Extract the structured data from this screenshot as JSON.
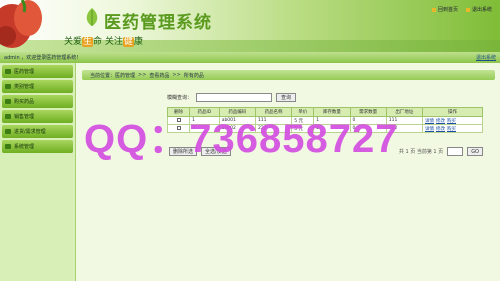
{
  "header": {
    "title": "医药管理系统",
    "slogan_parts": [
      "关爱",
      "生",
      "命  关注",
      "健",
      "康"
    ],
    "top_links": [
      "回到首页",
      "退出系统"
    ]
  },
  "welcome": {
    "text": "admin ，欢迎登录医药管理系统！",
    "logout": "退出系统"
  },
  "sidebar": {
    "items": [
      {
        "label": "医药管理"
      },
      {
        "label": "类别管理"
      },
      {
        "label": "购买药品"
      },
      {
        "label": "销售管理"
      },
      {
        "label": "进货/需求管理"
      },
      {
        "label": "系统管理"
      }
    ]
  },
  "breadcrumb": [
    "当前位置：医药管理",
    "查看药品",
    "所有药品"
  ],
  "breadcrumb_sep": ">>",
  "search": {
    "label": "模糊查询：",
    "button": "查询",
    "placeholder": ""
  },
  "table": {
    "headers": [
      "删除",
      "药品ID",
      "药品编码",
      "药品名称",
      "单价",
      "库存数量",
      "需求数量",
      "出厂地址",
      "操作"
    ],
    "rows": [
      {
        "id": "1",
        "code": "ab001",
        "name": "111",
        "price": "5 元",
        "stock": "1",
        "demand": "0",
        "address": "111"
      },
      {
        "id": "3",
        "code": "ab002",
        "name": "222",
        "price": "5 元",
        "stock": "2",
        "demand": "0",
        "address": "222"
      }
    ],
    "actions": [
      "详情",
      "修改",
      "购买"
    ]
  },
  "bottom": {
    "delete_button": "删除所选",
    "select_all_button": "全选/反选",
    "pager": "共 1 页 当前第 1 页",
    "go_button": "GO"
  },
  "watermark": "QQ：736858727"
}
